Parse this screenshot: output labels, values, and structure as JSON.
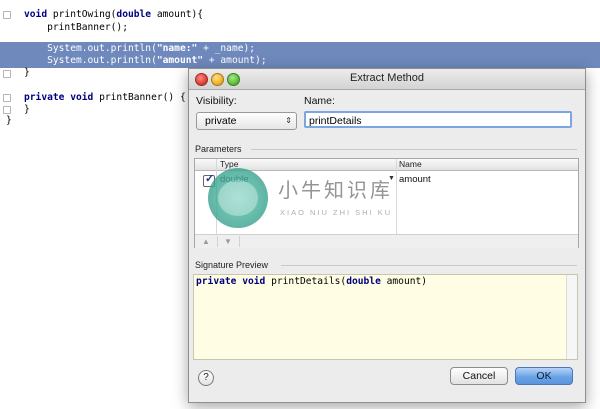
{
  "editor": {
    "lines": {
      "l1": {
        "kw1": "void",
        "t1": " printOwing(",
        "kw2": "double",
        "t2": " amount){"
      },
      "l2": "    printBanner();",
      "l3": {
        "t1": "    System.out.println(",
        "s1": "\"name:\"",
        "t2": " + _name);"
      },
      "l4": {
        "t1": "    System.out.println(",
        "s1": "\"amount\"",
        "t2": " + amount);"
      },
      "l5": "}",
      "l6": {
        "kw1": "private",
        "t0": " ",
        "kw2": "void",
        "t1": " printBanner() {"
      },
      "l7": "}",
      "l8": "}"
    }
  },
  "dialog": {
    "title": "Extract Method",
    "visibility_label": "Visibility:",
    "visibility_value": "private",
    "name_label": "Name:",
    "name_value": "printDetails",
    "parameters_label": "Parameters",
    "table": {
      "columns": {
        "type": "Type",
        "name": "Name"
      },
      "rows": [
        {
          "checked": true,
          "type": "double",
          "name": "amount"
        }
      ]
    },
    "signature_label": "Signature Preview",
    "signature": {
      "kw1": "private",
      "kw2": "void",
      "t1": " printDetails(",
      "kw3": "double",
      "t2": " amount)"
    },
    "help_label": "?",
    "cancel_label": "Cancel",
    "ok_label": "OK"
  },
  "watermark": {
    "text": "小牛知识库",
    "pinyin": "XIAO NIU ZHI SHI KU"
  },
  "colors": {
    "selection": "#6f89bd",
    "keyword": "#000080",
    "string": "#008000",
    "signature_bg": "#fffde3",
    "ok_button": "#6aa3e6"
  },
  "icons": {
    "visibility_arrows": "updown-arrows-icon",
    "move_up": "arrow-up-icon",
    "move_down": "arrow-down-icon",
    "dropdown": "triangle-down-icon"
  }
}
